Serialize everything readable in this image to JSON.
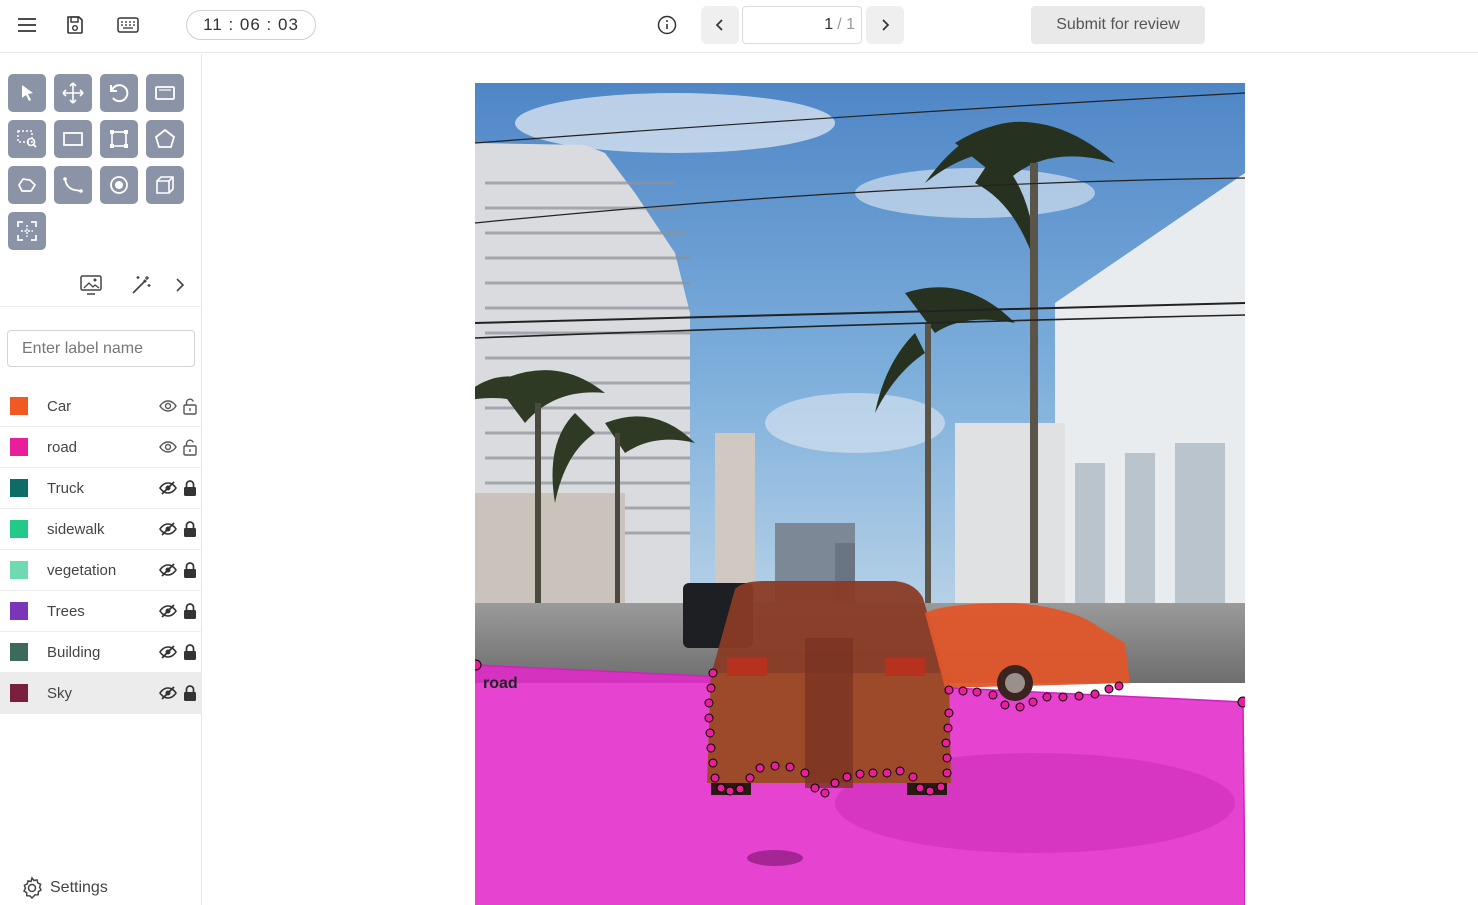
{
  "toolbar": {
    "timer": "11 : 06 : 03",
    "page_current": "1",
    "page_separator": "/ 1",
    "submit_label": "Submit for review"
  },
  "sidebar": {
    "search_placeholder": "Enter label name",
    "settings_label": "Settings",
    "labels": [
      {
        "name": "Car",
        "color": "#f05a22",
        "visible": true,
        "locked": false
      },
      {
        "name": "road",
        "color": "#e91e9a",
        "visible": true,
        "locked": false
      },
      {
        "name": "Truck",
        "color": "#0f6b66",
        "visible": false,
        "locked": true
      },
      {
        "name": "sidewalk",
        "color": "#22c98a",
        "visible": false,
        "locked": true
      },
      {
        "name": "vegetation",
        "color": "#6fd9b0",
        "visible": false,
        "locked": true
      },
      {
        "name": "Trees",
        "color": "#7b35b8",
        "visible": false,
        "locked": true
      },
      {
        "name": "Building",
        "color": "#3d6a5c",
        "visible": false,
        "locked": true
      },
      {
        "name": "Sky",
        "color": "#7a1f3d",
        "visible": false,
        "locked": true
      }
    ]
  },
  "canvas": {
    "road_annotation_label": "road"
  },
  "colors": {
    "tool_bg": "#8a94a6",
    "road_overlay": "#e22ac9",
    "car_overlay": "#e0552a"
  }
}
